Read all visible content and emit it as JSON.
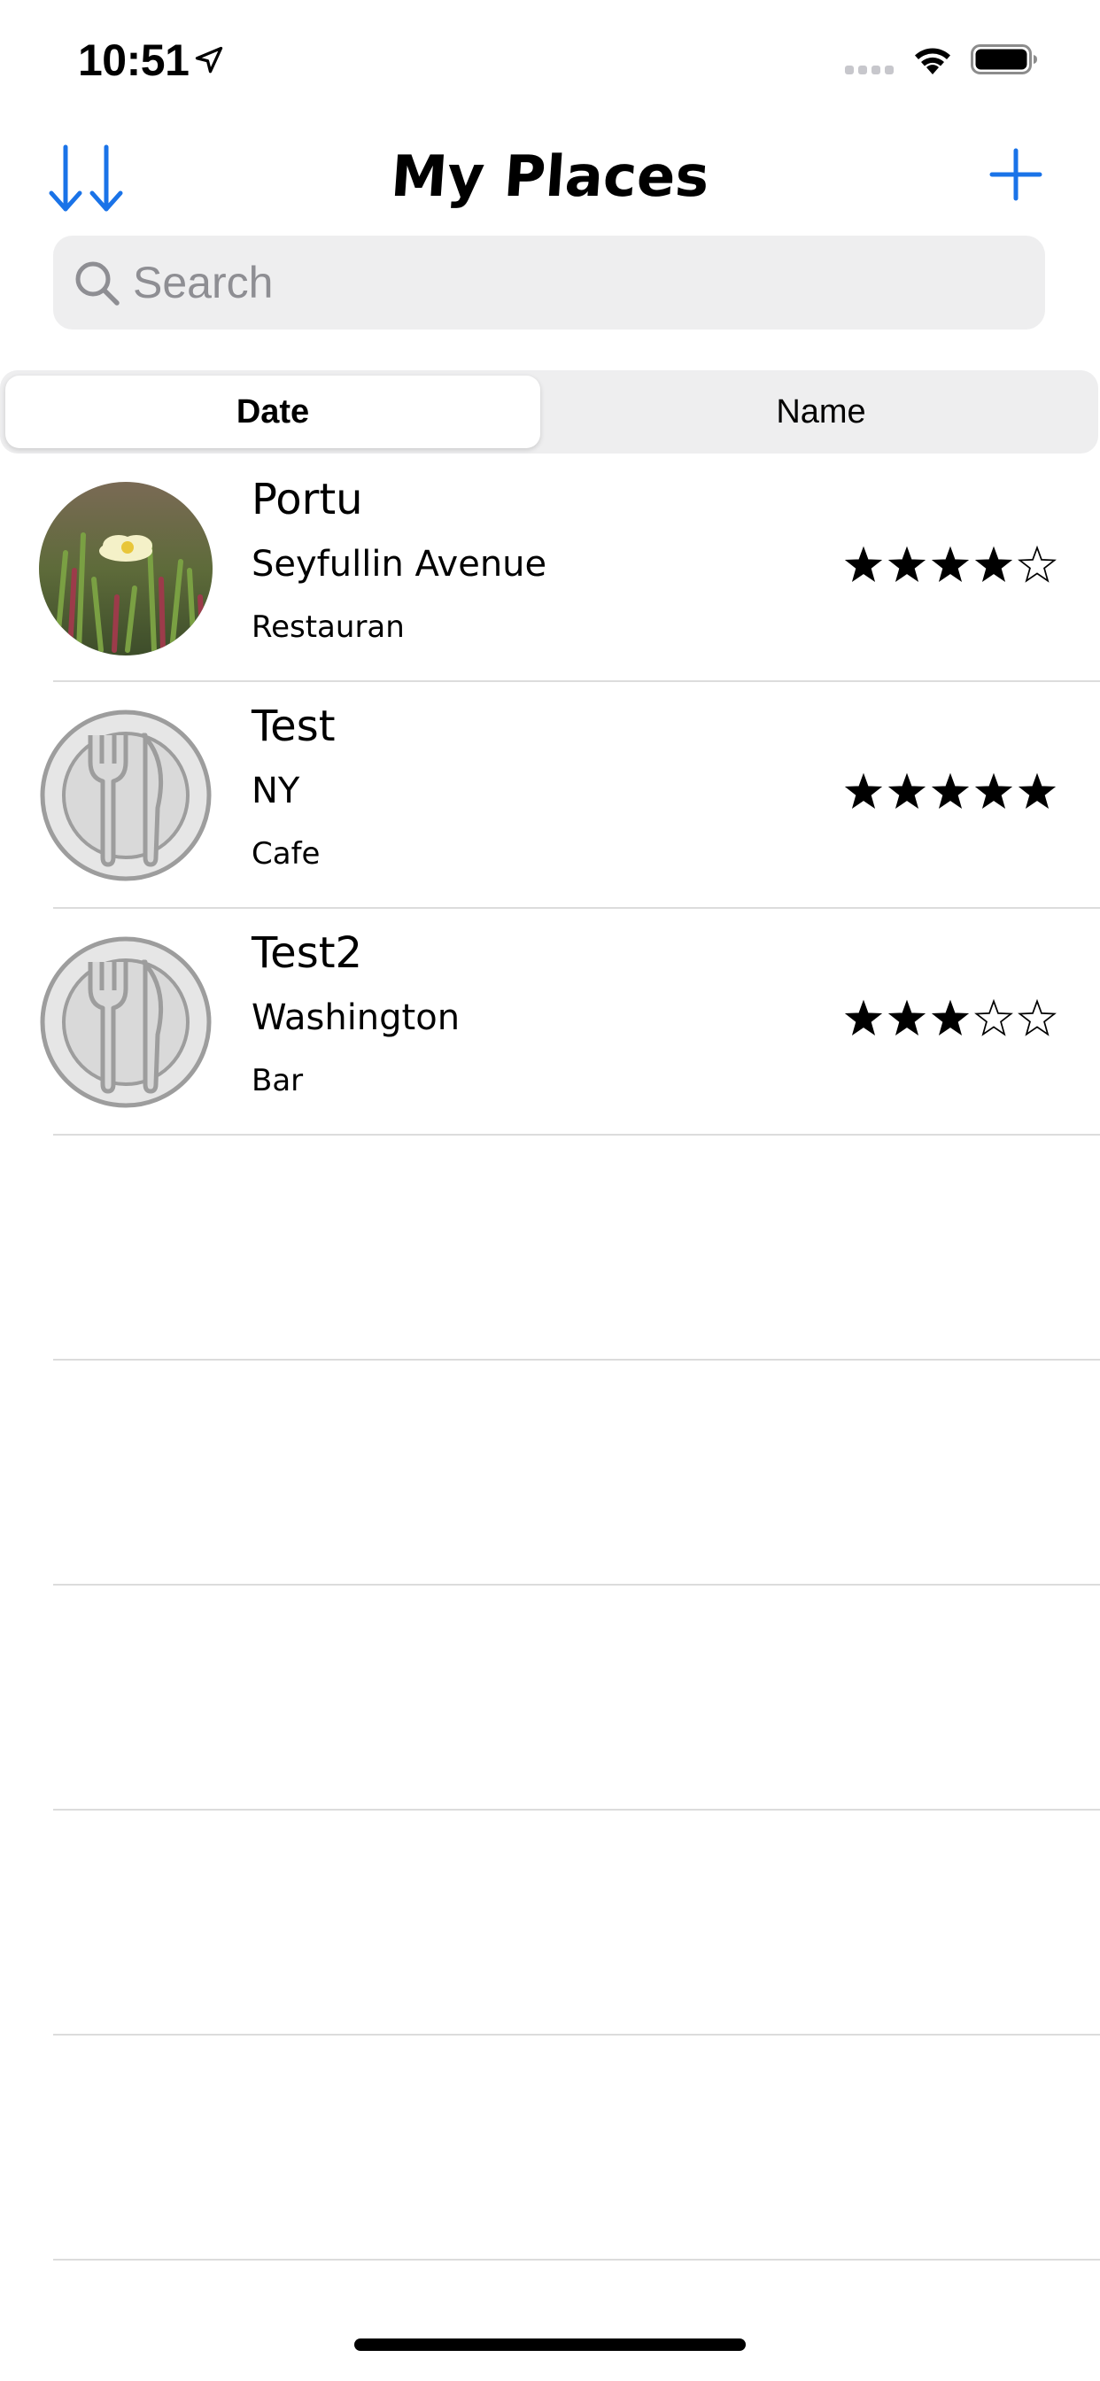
{
  "status_bar": {
    "time": "10:51",
    "icons": [
      "location-arrow-icon",
      "signal-icon",
      "wifi-icon",
      "battery-icon"
    ]
  },
  "nav": {
    "title": "My Places",
    "sort_icon": "sort-descending-icon",
    "add_icon": "plus-icon",
    "accent_color": "#1a73e8"
  },
  "search": {
    "placeholder": "Search",
    "value": ""
  },
  "segments": {
    "items": [
      {
        "label": "Date",
        "selected": true
      },
      {
        "label": "Name",
        "selected": false
      }
    ]
  },
  "places": [
    {
      "name": "Portu",
      "location": "Seyfullin Avenue",
      "type": "Restauran",
      "rating": 4,
      "image": "flower-photo"
    },
    {
      "name": "Test",
      "location": "NY",
      "type": "Cafe",
      "rating": 5,
      "image": "fork-knife-placeholder-icon"
    },
    {
      "name": "Test2",
      "location": "Washington",
      "type": "Bar",
      "rating": 3,
      "image": "fork-knife-placeholder-icon"
    }
  ],
  "rating_max": 5
}
